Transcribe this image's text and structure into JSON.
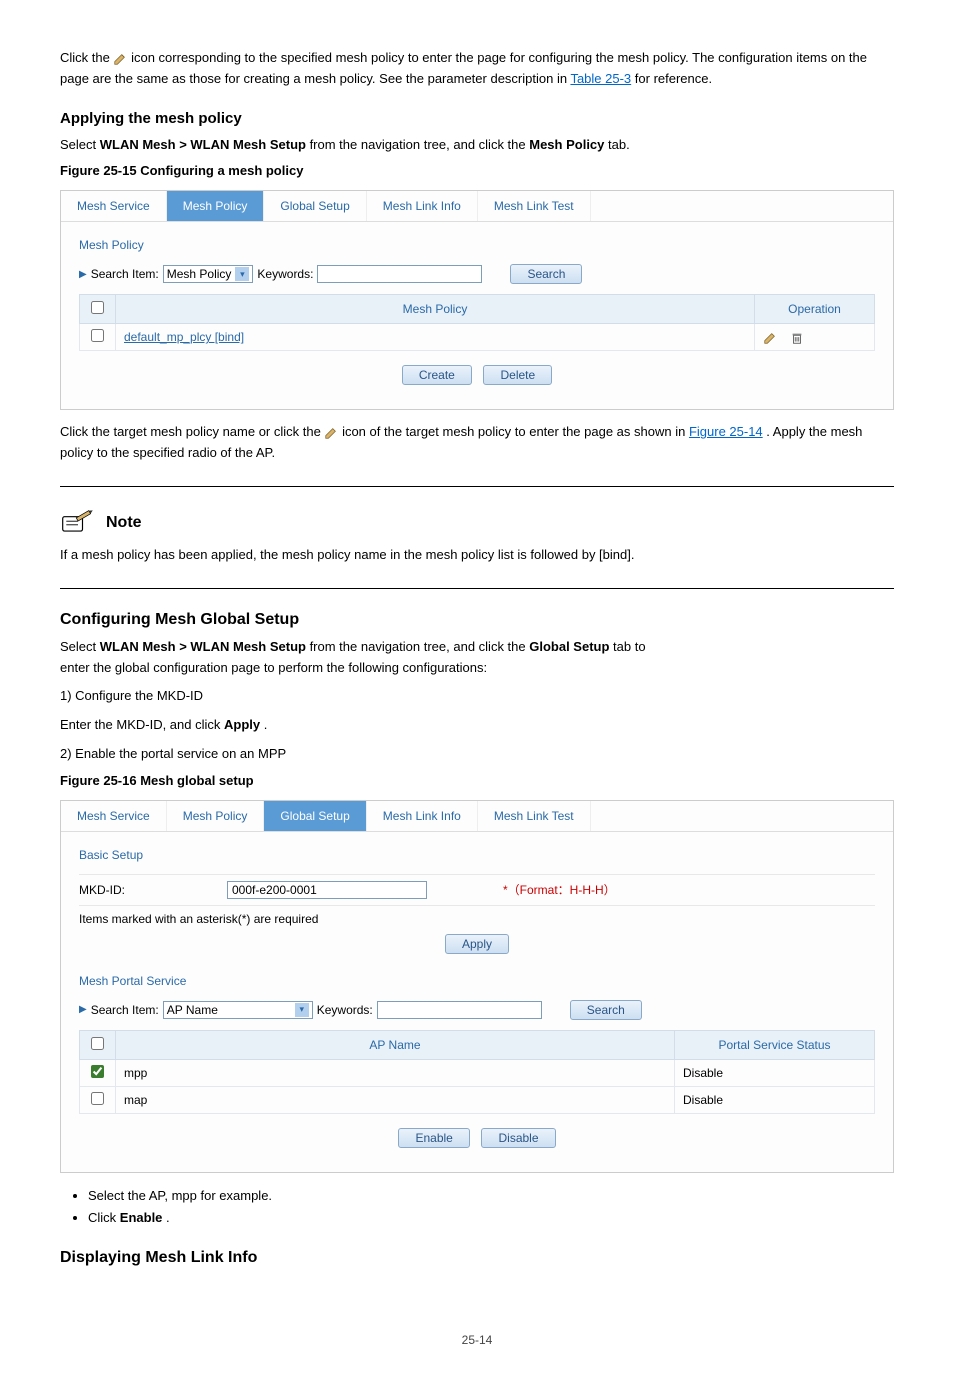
{
  "intro": {
    "line1_prefix": "Click the ",
    "line1_icon_hint": " icon corresponding to the specified mesh policy to enter the page for configuring the",
    "line2": "mesh policy. The configuration items on the page are the same as those for creating a mesh policy.",
    "line3_prefix": "See the parameter description in ",
    "line3_link": "Table 25-3",
    "line3_suffix": " for reference."
  },
  "step_heading": "Applying the mesh policy",
  "nav_prefix": "Select ",
  "nav_path": "WLAN Mesh > WLAN Mesh Setup ",
  "nav_suffix": "from the navigation tree, and click the ",
  "nav_tab": "Mesh Policy",
  "nav_suffix2": " tab.",
  "figure1_caption": "Figure 25-15 Configuring a mesh policy",
  "fig1": {
    "tabs": [
      "Mesh Service",
      "Mesh Policy",
      "Global Setup",
      "Mesh Link Info",
      "Mesh Link Test"
    ],
    "active_tab": 1,
    "panel_heading": "Mesh Policy",
    "search_label": "Search Item:",
    "search_select": "Mesh Policy",
    "keywords_label": "Keywords:",
    "keywords_value": "",
    "search_btn": "Search",
    "col_policy": "Mesh Policy",
    "col_op": "Operation",
    "row_policy": "default_mp_plcy [bind]",
    "create_btn": "Create",
    "delete_btn": "Delete"
  },
  "apply_instruction_prefix": "Click the target mesh policy name or click the ",
  "apply_instruction_suffix": " icon of the target mesh policy to enter the page as",
  "apply_ref_prefix": "shown in ",
  "apply_ref_link": "Figure 25-14",
  "apply_ref_suffix": ". Apply the mesh policy to the specified radio of the AP.",
  "note_label": "Note",
  "note_text": "If a mesh policy has been applied, the mesh policy name in the mesh policy list is followed by [bind].",
  "global_heading": "Configuring Mesh Global Setup",
  "global_nav_prefix": "Select ",
  "global_nav_path": "WLAN Mesh > WLAN Mesh Setup ",
  "global_nav_suffix": "from the navigation tree, and click the ",
  "global_nav_tab": "Global Setup",
  "global_nav_suffix2": " tab to",
  "global_nav_line2": "enter the global configuration page to perform the following configurations:",
  "step1": "1)  Configure the MKD-ID",
  "step1_line2_prefix": "Enter the MKD-ID, and click ",
  "step1_line2_bold": "Apply",
  "step1_line2_suffix": ".",
  "step2": "2)  Enable the portal service on an MPP",
  "figure2_caption": "Figure 25-16 Mesh global setup",
  "fig2": {
    "tabs": [
      "Mesh Service",
      "Mesh Policy",
      "Global Setup",
      "Mesh Link Info",
      "Mesh Link Test"
    ],
    "active_tab": 2,
    "basic_heading": "Basic Setup",
    "mkd_label": "MKD-ID:",
    "mkd_value": "000f-e200-0001",
    "mkd_hint": "*（Format：H-H-H）",
    "req_note": "Items marked with an asterisk(*) are required",
    "apply_btn": "Apply",
    "portal_heading": "Mesh Portal Service",
    "search_label": "Search Item:",
    "search_select": "AP Name",
    "keywords_label": "Keywords:",
    "search_btn": "Search",
    "col_ap": "AP Name",
    "col_status": "Portal Service Status",
    "rows": [
      {
        "ap": "mpp",
        "status": "Disable",
        "checked": true
      },
      {
        "ap": "map",
        "status": "Disable",
        "checked": false
      }
    ],
    "enable_btn": "Enable",
    "disable_btn": "Disable"
  },
  "post_bullets": [
    "Select the AP, mpp for example.",
    {
      "prefix": "Click ",
      "bold": "Enable",
      "suffix": "."
    }
  ],
  "subsection_heading": "Displaying Mesh Link Info",
  "page_number": "25-14"
}
